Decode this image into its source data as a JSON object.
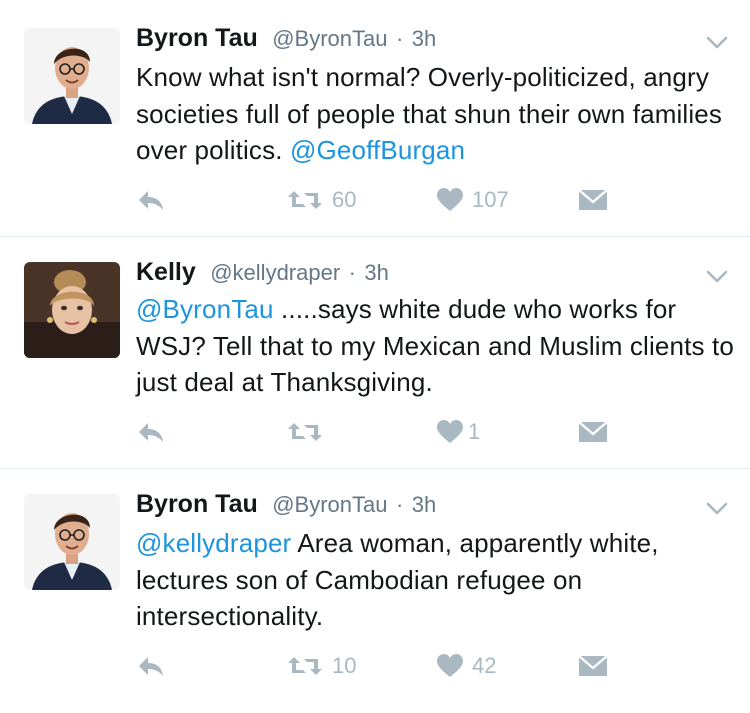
{
  "tweets": [
    {
      "author": {
        "name": "Byron Tau",
        "handle": "@ByronTau"
      },
      "separator": "·",
      "time": "3h",
      "text_before": "Know what isn't normal? Overly-politicized, angry societies full of people that shun their own families over politics. ",
      "mention": "@GeoffBurgan",
      "text_after": "",
      "retweets": "60",
      "likes": "107"
    },
    {
      "author": {
        "name": "Kelly",
        "handle": "@kellydraper"
      },
      "separator": "·",
      "time": "3h",
      "text_before": "",
      "mention": "@ByronTau",
      "text_after": " .....says white dude who works for WSJ? Tell that to my Mexican and Muslim clients to just deal at Thanksgiving.",
      "retweets": "",
      "likes": "1"
    },
    {
      "author": {
        "name": "Byron Tau",
        "handle": "@ByronTau"
      },
      "separator": "·",
      "time": "3h",
      "text_before": "",
      "mention": "@kellydraper",
      "text_after": " Area woman, apparently white, lectures son of Cambodian refugee on intersectionality.",
      "retweets": "10",
      "likes": "42"
    }
  ],
  "colors": {
    "link": "#1b95e0",
    "muted": "#657786",
    "action_gray": "#aab8c2",
    "divider": "#e1e8ed"
  },
  "icons": [
    "caret-down-icon",
    "reply-icon",
    "retweet-icon",
    "heart-icon",
    "dm-envelope-icon"
  ]
}
